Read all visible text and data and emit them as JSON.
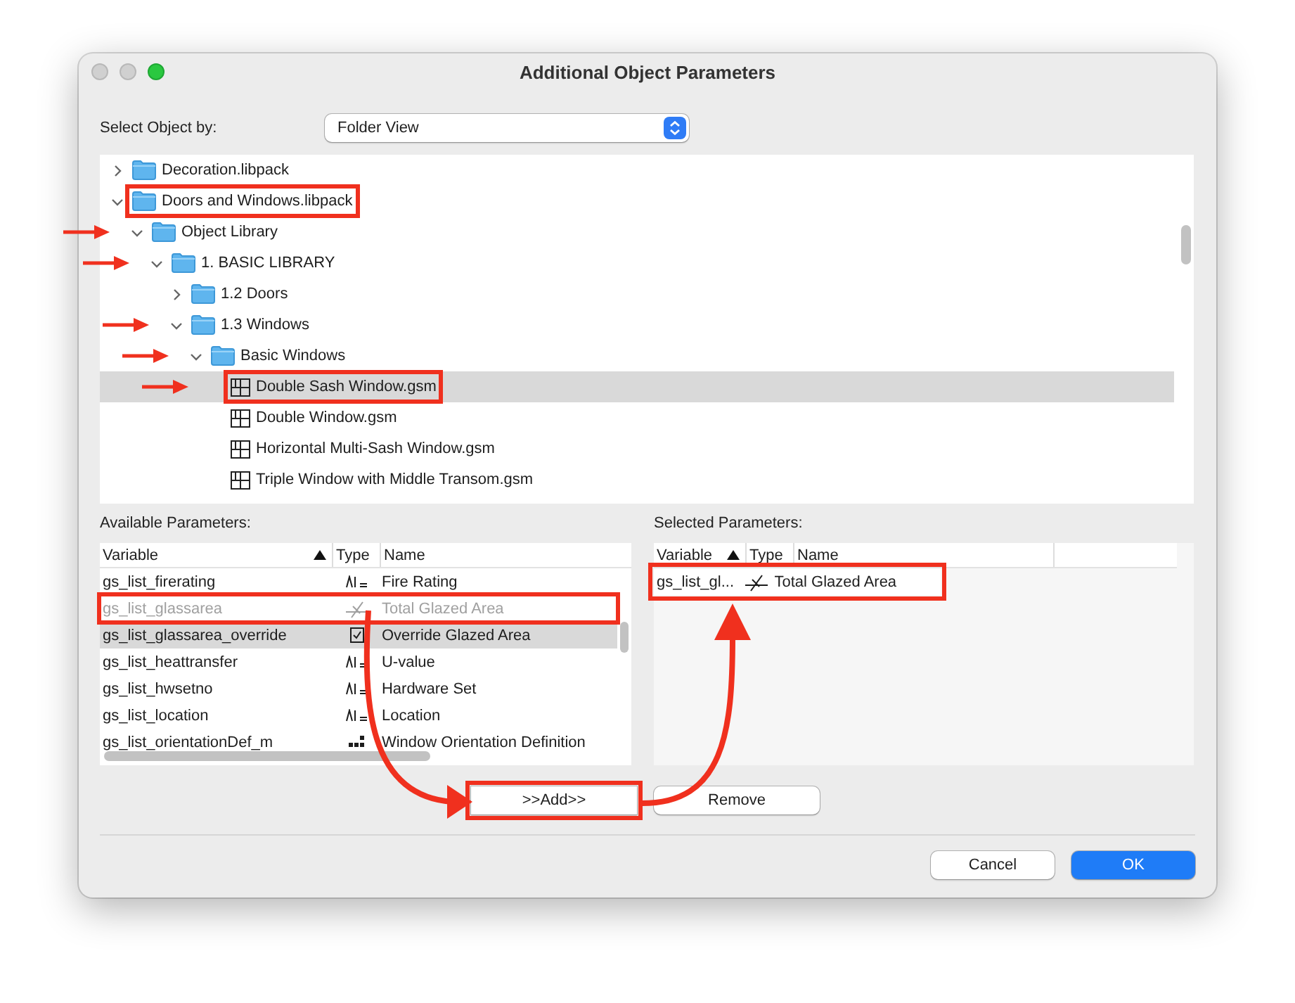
{
  "window": {
    "title": "Additional Object Parameters"
  },
  "select_by": {
    "label": "Select Object by:",
    "value": "Folder View"
  },
  "tree": [
    {
      "label": "Decoration.libpack",
      "kind": "folder",
      "expanded": false,
      "selected": false,
      "highlighted": false,
      "arrow": false
    },
    {
      "label": "Doors and Windows.libpack",
      "kind": "folder",
      "expanded": true,
      "selected": false,
      "highlighted": true,
      "arrow": false,
      "children": [
        {
          "label": "Object Library",
          "kind": "folder",
          "expanded": true,
          "selected": false,
          "highlighted": false,
          "arrow": true,
          "children": [
            {
              "label": "1. BASIC LIBRARY",
              "kind": "folder",
              "expanded": true,
              "selected": false,
              "highlighted": false,
              "arrow": true,
              "children": [
                {
                  "label": "1.2 Doors",
                  "kind": "folder",
                  "expanded": false,
                  "selected": false,
                  "highlighted": false,
                  "arrow": false
                },
                {
                  "label": "1.3 Windows",
                  "kind": "folder",
                  "expanded": true,
                  "selected": false,
                  "highlighted": false,
                  "arrow": true,
                  "children": [
                    {
                      "label": "Basic Windows",
                      "kind": "folder",
                      "expanded": true,
                      "selected": false,
                      "highlighted": false,
                      "arrow": true,
                      "children": [
                        {
                          "label": "Double Sash Window.gsm",
                          "kind": "object",
                          "selected": true,
                          "highlighted": true,
                          "arrow": true
                        },
                        {
                          "label": "Double Window.gsm",
                          "kind": "object",
                          "selected": false,
                          "highlighted": false,
                          "arrow": false
                        },
                        {
                          "label": "Horizontal Multi-Sash Window.gsm",
                          "kind": "object",
                          "selected": false,
                          "highlighted": false,
                          "arrow": false
                        },
                        {
                          "label": "Triple Window with Middle Transom.gsm",
                          "kind": "object",
                          "selected": false,
                          "highlighted": false,
                          "arrow": false
                        }
                      ]
                    }
                  ]
                }
              ]
            }
          ]
        }
      ]
    }
  ],
  "available": {
    "label": "Available Parameters:",
    "columns": [
      {
        "label": "Variable",
        "sorted": true
      },
      {
        "label": "Type",
        "sorted": false
      },
      {
        "label": "Name",
        "sorted": false
      }
    ],
    "rows": [
      {
        "variable": "gs_list_firerating",
        "kind": "text",
        "name": "Fire Rating",
        "disabled": false,
        "selected": false,
        "highlighted": false
      },
      {
        "variable": "gs_list_glassarea",
        "kind": "area",
        "name": "Total Glazed Area",
        "disabled": true,
        "selected": false,
        "highlighted": true
      },
      {
        "variable": "gs_list_glassarea_override",
        "kind": "boolean",
        "name": "Override Glazed Area",
        "disabled": false,
        "selected": true,
        "highlighted": false
      },
      {
        "variable": "gs_list_heattransfer",
        "kind": "text",
        "name": "U-value",
        "disabled": false,
        "selected": false,
        "highlighted": false
      },
      {
        "variable": "gs_list_hwsetno",
        "kind": "text",
        "name": "Hardware Set",
        "disabled": false,
        "selected": false,
        "highlighted": false
      },
      {
        "variable": "gs_list_location",
        "kind": "text",
        "name": "Location",
        "disabled": false,
        "selected": false,
        "highlighted": false
      },
      {
        "variable": "gs_list_orientationDef_m",
        "kind": "list",
        "name": "Window Orientation Definition",
        "disabled": false,
        "selected": false,
        "highlighted": false
      }
    ]
  },
  "selected_params": {
    "label": "Selected Parameters:",
    "columns": [
      {
        "label": "Variable",
        "sorted": true
      },
      {
        "label": "Type",
        "sorted": false
      },
      {
        "label": "Name",
        "sorted": false
      }
    ],
    "rows": [
      {
        "variable": "gs_list_gl...",
        "kind": "area",
        "name": "Total Glazed Area",
        "highlighted": true
      }
    ]
  },
  "add_button": {
    "label": ">>Add>>",
    "highlighted": true
  },
  "remove_button": {
    "label": "Remove",
    "highlighted": false
  },
  "footer_buttons": [
    {
      "label": "Cancel",
      "kind": "secondary"
    },
    {
      "label": "OK",
      "kind": "primary"
    }
  ]
}
